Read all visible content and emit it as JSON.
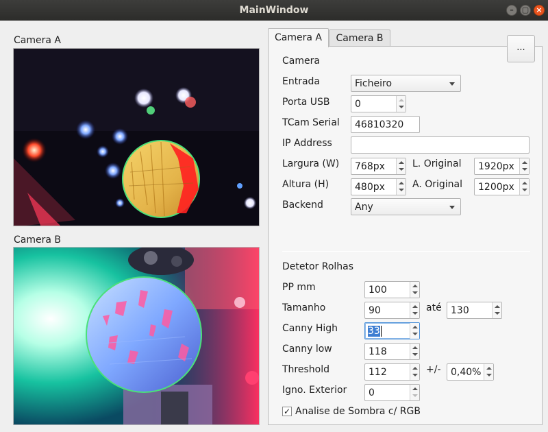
{
  "window": {
    "title": "MainWindow"
  },
  "views": {
    "camera_a_label": "Camera A",
    "camera_b_label": "Camera B"
  },
  "tabs": {
    "items": [
      "Camera A",
      "Camera B"
    ],
    "active": "Camera A",
    "more_label": "..."
  },
  "camera": {
    "section_title": "Camera",
    "entrada_label": "Entrada",
    "entrada_value": "Ficheiro",
    "porta_usb_label": "Porta USB",
    "porta_usb_value": "0",
    "tcam_serial_label": "TCam Serial",
    "tcam_serial_value": "46810320",
    "ip_address_label": "IP Address",
    "ip_address_value": "",
    "largura_label": "Largura (W)",
    "largura_value": "768px",
    "l_original_label": "L. Original",
    "l_original_value": "1920px",
    "altura_label": "Altura (H)",
    "altura_value": "480px",
    "a_original_label": "A. Original",
    "a_original_value": "1200px",
    "backend_label": "Backend",
    "backend_value": "Any"
  },
  "detector": {
    "section_title": "Detetor Rolhas",
    "pp_mm_label": "PP mm",
    "pp_mm_value": "100",
    "tamanho_label": "Tamanho",
    "tamanho_min": "90",
    "ate_label": "até",
    "tamanho_max": "130",
    "canny_high_label": "Canny High",
    "canny_high_value": "33",
    "canny_low_label": "Canny low",
    "canny_low_value": "118",
    "threshold_label": "Threshold",
    "threshold_value": "112",
    "plus_minus_label": "+/-",
    "tolerance_value": "0,40%",
    "igno_exterior_label": "Igno. Exterior",
    "igno_exterior_value": "0",
    "shadow_checkbox_label": "Analise de Sombra c/ RGB",
    "shadow_checkbox_checked": true
  }
}
